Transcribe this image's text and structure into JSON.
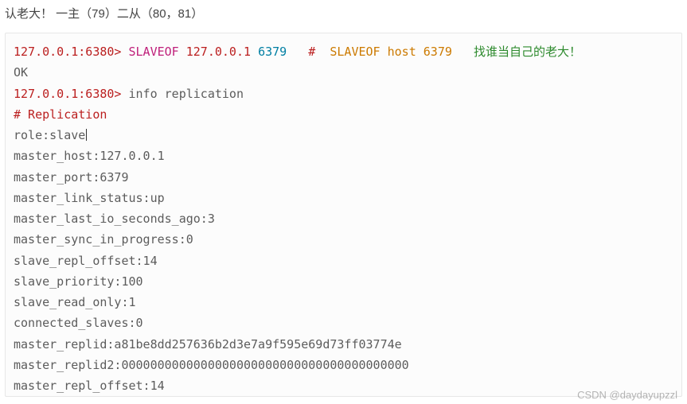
{
  "header": "认老大！ 一主（79）二从（80，81）",
  "prompt1": "127.0.0.1:6380>",
  "cmd1": "SLAVEOF",
  "arg_host": "127.0.0.1",
  "arg_port": "6379",
  "hash": "#",
  "comment_cmd": "SLAVEOF host 6379",
  "comment_cn": "找谁当自己的老大！",
  "ok": "OK",
  "prompt2": "127.0.0.1:6380>",
  "cmd2": "info replication",
  "section": "# Replication",
  "lines": {
    "role": "role:slave",
    "mhost": "master_host:127.0.0.1",
    "mport": "master_port:6379",
    "mlink": "master_link_status:up",
    "mlastio": "master_last_io_seconds_ago:3",
    "msync": "master_sync_in_progress:0",
    "sreploff": "slave_repl_offset:14",
    "sprio": "slave_priority:100",
    "sreadonly": "slave_read_only:1",
    "cslaves": "connected_slaves:0",
    "mreplid": "master_replid:a81be8dd257636b2d3e7a9f595e69d73ff03774e",
    "mreplid2": "master_replid2:0000000000000000000000000000000000000000",
    "mreploff": "master_repl_offset:14"
  },
  "watermark": "CSDN @daydayupzzl"
}
